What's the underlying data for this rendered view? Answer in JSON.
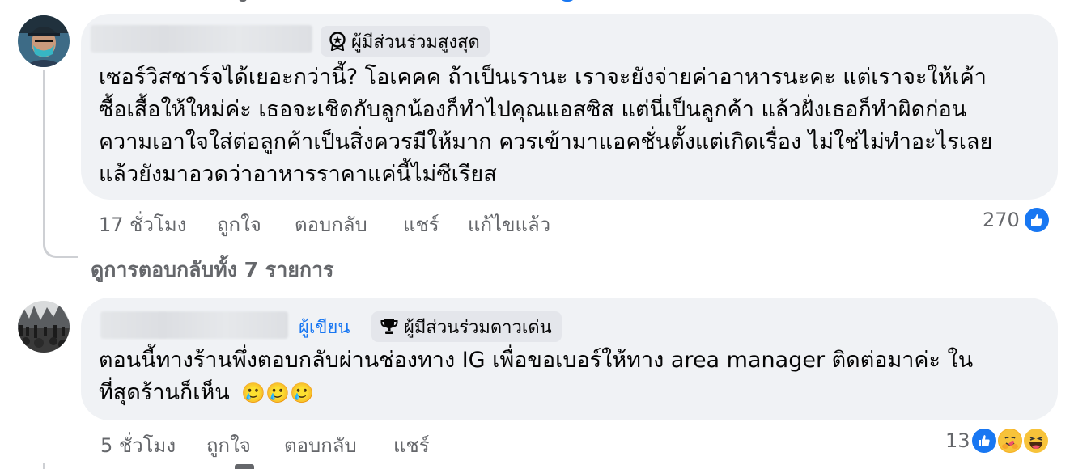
{
  "comments": [
    {
      "badge": {
        "icon": "star-badge-icon",
        "label": "ผู้มีส่วนร่วมสูงสุด"
      },
      "lines": [
        "เซอร์วิสชาร์จได้เยอะกว่านี้? โอเคคค ถ้าเป็นเรานะ เราจะยังจ่ายค่าอาหารนะคะ แต่เราจะให้เค้า",
        "ซื้อเสื้อให้ใหม่ค่ะ เธอจะเชิดกับลูกน้องก็ทำไปคุณแอสซิส แต่นี่เป็นลูกค้า แล้วฝั่งเธอก็ทำผิดก่อน",
        "ความเอาใจใส่ต่อลูกค้าเป็นสิ่งควรมีให้มาก ควรเข้ามาแอคชั่นตั้งแต่เกิดเรื่อง ไม่ใช่ไม่ทำอะไรเลย",
        "แล้วยังมาอวดว่าอาหารราคาแค่นี้ไม่ซีเรียส"
      ],
      "time": "17 ชั่วโมง",
      "like": "ถูกใจ",
      "reply": "ตอบกลับ",
      "share": "แชร์",
      "edited": "แก้ไขแล้ว",
      "reaction_count": "270",
      "view_replies": "ดูการตอบกลับทั้ง 7 รายการ"
    },
    {
      "author_label": "ผู้เขียน",
      "badge": {
        "icon": "trophy-icon",
        "label": "ผู้มีส่วนร่วมดาวเด่น"
      },
      "lines": [
        "ตอนนี้ทางร้านพึ่งตอบกลับผ่านช่องทาง IG เพื่อขอเบอร์ให้ทาง area manager ติดต่อมาค่ะ ใน",
        "ที่สุดร้านก็เห็น"
      ],
      "emojis": "🥲🥲🥲",
      "time": "5 ชั่วโมง",
      "like": "ถูกใจ",
      "reply": "ตอบกลับ",
      "share": "แชร์",
      "reaction_count": "13"
    }
  ],
  "colors": {
    "like_blue": "#1877f2",
    "bubble": "#f0f2f5",
    "meta": "#65676b"
  }
}
